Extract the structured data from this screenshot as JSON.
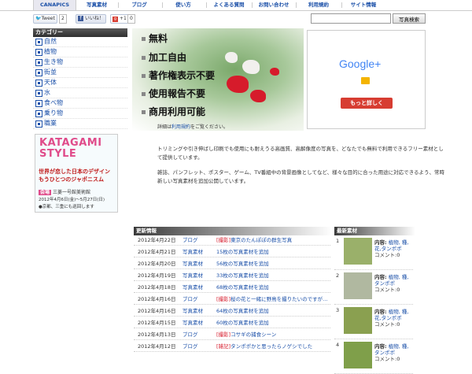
{
  "nav": {
    "items": [
      "CANAPICS",
      "写真素材",
      "ブログ",
      "使い方",
      "よくある質問",
      "お問い合わせ",
      "利用規約",
      "サイト情報"
    ]
  },
  "social": {
    "tweet_label": "Tweet",
    "tweet_count": "2",
    "like_label": "いいね！",
    "gplus_label": "+1",
    "gplus_count": "0"
  },
  "search": {
    "placeholder": "",
    "button_label": "写真検索"
  },
  "sidebar": {
    "title": "カテゴリー",
    "items": [
      "自然",
      "植物",
      "生き物",
      "街並",
      "天体",
      "水",
      "食べ物",
      "乗り物",
      "職業"
    ]
  },
  "banner": {
    "line1": "KATAGAMI",
    "line2": "STYLE",
    "red1": "世界が恋した日本のデザイン",
    "red2": "もうひとつのジャポニスム",
    "venue_badge": "会場",
    "venue": "三菱一号館美術館",
    "dates": "2012年4月6日(金)～5月27日(日)",
    "note": "●京都、三重にも巡回します"
  },
  "hero": {
    "features": [
      "無料",
      "加工自由",
      "著作権表示不要",
      "使用報告不要",
      "商用利用可能"
    ],
    "details_prefix": "詳細は",
    "details_link": "利用規約",
    "details_suffix": "をご覧ください。"
  },
  "ad": {
    "logo": "Google+",
    "button": "もっと詳しく",
    "colors": {
      "blue": "#4285f4",
      "red": "#db4437",
      "yellow": "#f4b400",
      "green": "#0f9d58"
    }
  },
  "intro": {
    "p1": "トリミングや引き伸ばし印刷でも使用にも耐えうる高画質、高解像度の写真を、どなたでも無料で利用できるフリー素材として提供しています。",
    "p2": "雑誌、パンフレット、ポスター、ゲーム、TV番組中の背景画像としてなど、様々な目的に合った用途に対応できるよう、常時新しい写真素材を追加公開しています。"
  },
  "updates": {
    "title": "更新情報",
    "rows": [
      {
        "date": "2012年4月22日",
        "cat": "ブログ",
        "tag": "[撮影]",
        "text": "東京のたんぽぽの群生写真"
      },
      {
        "date": "2012年4月21日",
        "cat": "写真素材",
        "tag": "",
        "text": "15枚の写真素材を追加"
      },
      {
        "date": "2012年4月20日",
        "cat": "写真素材",
        "tag": "",
        "text": "56枚の写真素材を追加"
      },
      {
        "date": "2012年4月19日",
        "cat": "写真素材",
        "tag": "",
        "text": "33枚の写真素材を追加"
      },
      {
        "date": "2012年4月18日",
        "cat": "写真素材",
        "tag": "",
        "text": "68枚の写真素材を追加"
      },
      {
        "date": "2012年4月16日",
        "cat": "ブログ",
        "tag": "[撮影]",
        "text": "桜の花と一緒に野鳥を撮りたいのですが…"
      },
      {
        "date": "2012年4月16日",
        "cat": "写真素材",
        "tag": "",
        "text": "64枚の写真素材を追加"
      },
      {
        "date": "2012年4月15日",
        "cat": "写真素材",
        "tag": "",
        "text": "60枚の写真素材を追加"
      },
      {
        "date": "2012年4月13日",
        "cat": "ブログ",
        "tag": "[撮影]",
        "text": "コサギの捕食シーン"
      },
      {
        "date": "2012年4月12日",
        "cat": "ブログ",
        "tag": "[雑記]",
        "text": "タンポポかと思ったらノゲシでした"
      }
    ]
  },
  "new_materials": {
    "title": "最新素材",
    "items": [
      {
        "num": "1",
        "label": "内容:",
        "tags": "植物, 種,花,タンポポ",
        "comments": "コメント:0"
      },
      {
        "num": "2",
        "label": "内容:",
        "tags": "植物, 種,タンポポ",
        "comments": "コメント:0"
      },
      {
        "num": "3",
        "label": "内容:",
        "tags": "植物, 種,花,タンポポ",
        "comments": "コメント:0"
      },
      {
        "num": "4",
        "label": "内容:",
        "tags": "植物, 種,タンポポ",
        "comments": "コメント:0"
      }
    ]
  }
}
